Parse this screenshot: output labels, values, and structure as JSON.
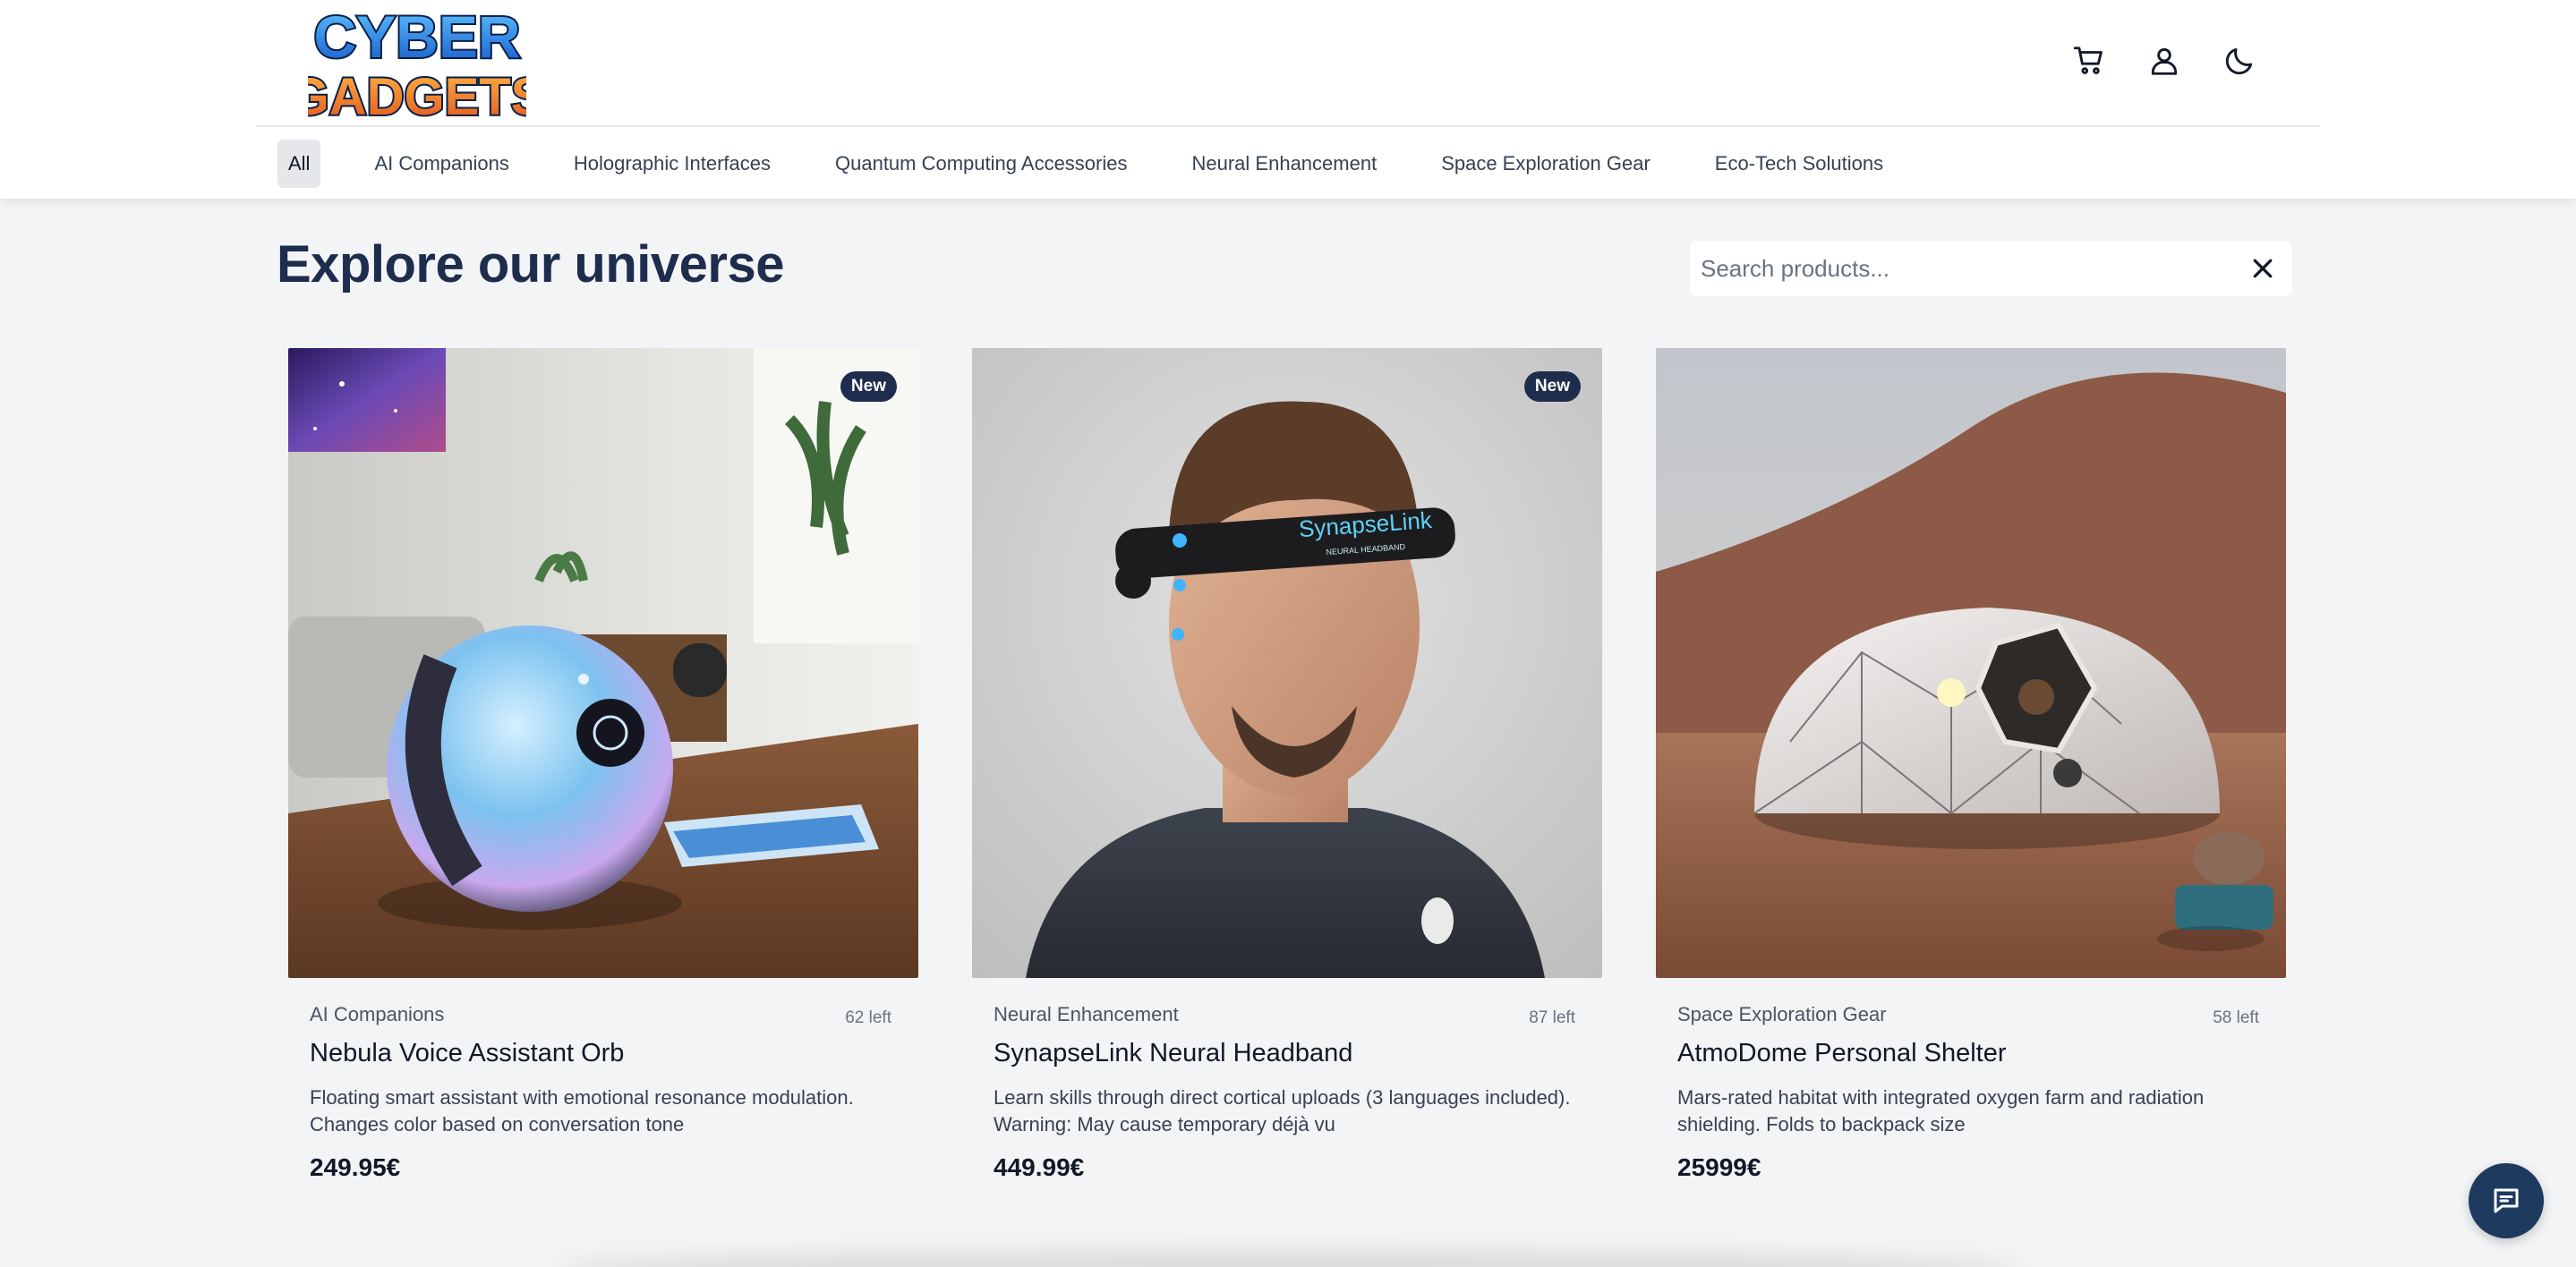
{
  "header": {
    "logo_line1": "CYBER",
    "logo_line2": "GADGETS",
    "icons": [
      "cart-icon",
      "user-icon",
      "moon-icon"
    ]
  },
  "categories": [
    {
      "label": "All",
      "active": true
    },
    {
      "label": "AI Companions"
    },
    {
      "label": "Holographic Interfaces"
    },
    {
      "label": "Quantum Computing Accessories"
    },
    {
      "label": "Neural Enhancement"
    },
    {
      "label": "Space Exploration Gear"
    },
    {
      "label": "Eco-Tech Solutions"
    }
  ],
  "main": {
    "title": "Explore our universe",
    "search_placeholder": "Search products..."
  },
  "products": [
    {
      "badge": "New",
      "category": "AI Companions",
      "stock": "62 left",
      "name": "Nebula Voice Assistant Orb",
      "description": "Floating smart assistant with emotional resonance modulation. Changes color based on conversation tone",
      "price": "249.95€"
    },
    {
      "badge": "New",
      "category": "Neural Enhancement",
      "stock": "87 left",
      "name": "SynapseLink Neural Headband",
      "description": "Learn skills through direct cortical uploads (3 languages included). Warning: May cause temporary déjà vu",
      "price": "449.99€",
      "image_text_1": "SynapseLink",
      "image_text_2": "NEURAL HEADBAND"
    },
    {
      "category": "Space Exploration Gear",
      "stock": "58 left",
      "name": "AtmoDome Personal Shelter",
      "description": "Mars-rated habitat with integrated oxygen farm and radiation shielding. Folds to backpack size",
      "price": "25999€"
    }
  ],
  "colors": {
    "brand_navy": "#1e2d4d",
    "chat_button": "#1e3a5f",
    "page_bg": "#f3f4f6"
  }
}
